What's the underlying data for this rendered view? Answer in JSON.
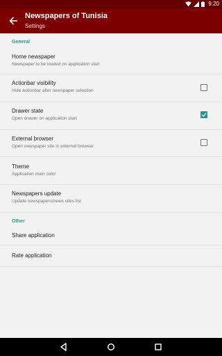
{
  "status_bar": {
    "time": "9:20",
    "icons": [
      "wifi-icon",
      "signal-icon",
      "battery-icon"
    ]
  },
  "app_bar": {
    "title": "Newspapers of Tunisia",
    "subtitle": "Settings",
    "back_icon": "arrow-back-icon"
  },
  "sections": {
    "general": "General",
    "other": "Other"
  },
  "prefs": {
    "home_newspaper": {
      "title": "Home newspaper",
      "summary": "Newspaper to be loaded on application start"
    },
    "actionbar": {
      "title": "Actionbar visibility",
      "summary": "Hide actionbar after newspaper selection",
      "checked": false
    },
    "drawer": {
      "title": "Drawer state",
      "summary": "Open drawer on application start",
      "checked": true
    },
    "browser": {
      "title": "External browser",
      "summary": "Open newspaper site in external browser",
      "checked": false
    },
    "theme": {
      "title": "Theme",
      "summary": "Application main color"
    },
    "update": {
      "title": "Newspapers update",
      "summary": "Update newspapers/news sites list"
    },
    "share": {
      "title": "Share application"
    },
    "rate": {
      "title": "Rate application"
    }
  },
  "nav_bar": {
    "icons": [
      "back-triangle-icon",
      "home-circle-icon",
      "recents-square-icon"
    ]
  },
  "colors": {
    "app_bar": "#7d0000",
    "status_bar": "#650000",
    "accent": "#1e9a8c",
    "category": "#2a9d8f"
  }
}
